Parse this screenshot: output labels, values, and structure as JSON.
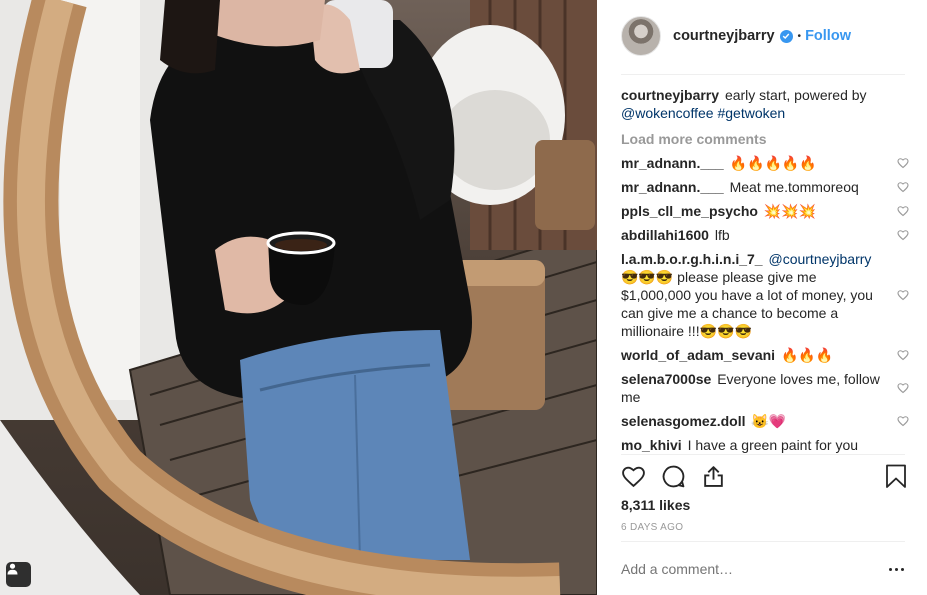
{
  "post": {
    "username": "courtneyjbarry",
    "dot": "•",
    "follow_label": "Follow",
    "caption_user": "courtneyjbarry",
    "caption_text": "early start, powered by",
    "caption_mention": "@wokencoffee",
    "caption_hashtag": "#getwoken",
    "load_more": "Load more comments",
    "likes": "8,311 likes",
    "time": "6 DAYS AGO",
    "add_comment_placeholder": "Add a comment…"
  },
  "comments": [
    {
      "user": "mr_adnann.___",
      "text": "🔥🔥🔥🔥🔥"
    },
    {
      "user": "mr_adnann.___",
      "text": "Meat me.tommoreoq"
    },
    {
      "user": "ppls_cll_me_psycho",
      "text": "💥💥💥"
    },
    {
      "user": "abdillahi1600",
      "text": "lfb"
    },
    {
      "user": "l.a.m.b.o.r.g.h.i.n.i_7_",
      "mention": "@courtneyjbarry",
      "text": "😎😎😎 please please give me $1,000,000 you have a lot of money, you can give me a chance to become a millionaire !!!😎😎😎"
    },
    {
      "user": "world_of_adam_sevani",
      "text": "🔥🔥🔥"
    },
    {
      "user": "selena7000se",
      "text": "Everyone loves me, follow me"
    },
    {
      "user": "selenasgomez.doll",
      "text": "😺💗"
    },
    {
      "user": "mo_khivi",
      "text": "I have a green paint for you"
    }
  ],
  "icons": {
    "verified": "verified-badge-icon",
    "like": "heart-outline-icon",
    "comment": "comment-bubble-icon",
    "share": "share-upload-icon",
    "save": "bookmark-icon",
    "more": "ellipsis-icon",
    "tag": "user-tag-icon"
  },
  "colors": {
    "accent": "#3897f0",
    "mention": "#003569",
    "muted": "#999999",
    "text": "#262626"
  }
}
